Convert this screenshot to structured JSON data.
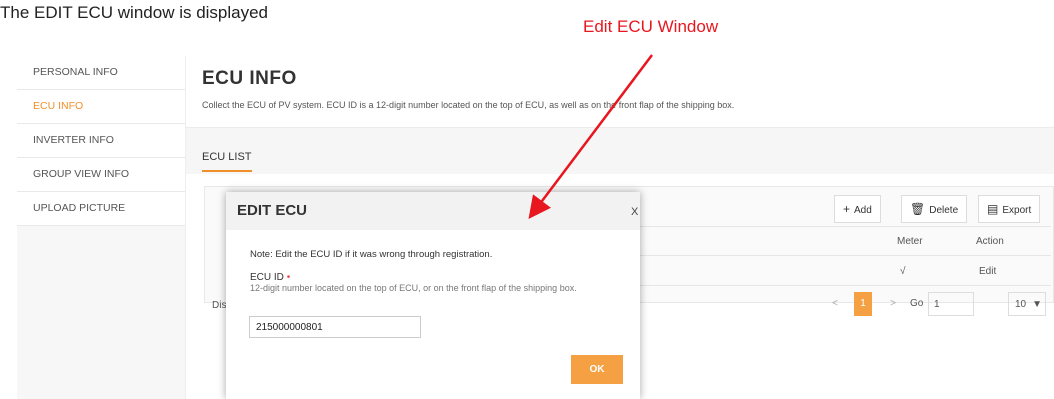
{
  "caption": "The EDIT ECU window is displayed",
  "annotation": {
    "label": "Edit ECU Window",
    "color": "#e8161e"
  },
  "sidebar": {
    "items": [
      {
        "label": "PERSONAL INFO"
      },
      {
        "label": "ECU INFO",
        "active": true
      },
      {
        "label": "INVERTER INFO"
      },
      {
        "label": "GROUP VIEW INFO"
      },
      {
        "label": "UPLOAD PICTURE"
      }
    ]
  },
  "main": {
    "title": "ECU INFO",
    "description": "Collect the ECU of PV system. ECU ID is a 12-digit number located on the top of ECU, as well as on the front flap of the shipping box.",
    "tab": "ECU LIST",
    "toolbar": {
      "add": "Add",
      "delete": "Delete",
      "export": "Export"
    },
    "table": {
      "columns": [
        "Meter",
        "Action"
      ],
      "row": {
        "meter": "√",
        "action": "Edit"
      },
      "footer_prefix": "Dis"
    },
    "pager": {
      "current_page": "1",
      "go_label": "Go",
      "go_value": "1",
      "page_size": "10"
    }
  },
  "dialog": {
    "title": "EDIT ECU",
    "close": "X",
    "note": "Note:   Edit the ECU ID if it was wrong through registration.",
    "field_label": "ECU ID",
    "required_mark": "•",
    "help": "12-digit number located on the top of ECU, or on the front flap of the shipping box.",
    "ecu_id": "215000000801",
    "ok": "OK"
  },
  "colors": {
    "accent": "#f0902a",
    "ok_button": "#f4a043"
  }
}
